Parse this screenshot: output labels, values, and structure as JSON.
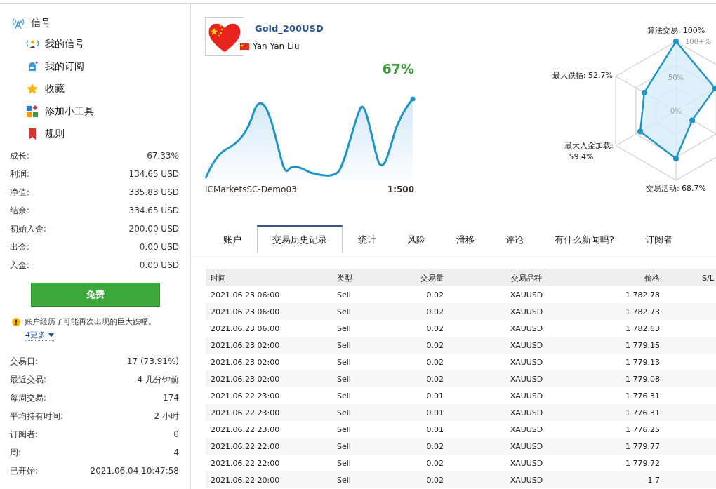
{
  "sidebar": {
    "header": "信号",
    "nav": [
      {
        "label": "我的信号",
        "kind": "signal"
      },
      {
        "label": "我的订阅",
        "kind": "subscription"
      },
      {
        "label": "收藏",
        "kind": "star"
      },
      {
        "label": "添加小工具",
        "kind": "widgets"
      },
      {
        "label": "规则",
        "kind": "bookmark"
      }
    ]
  },
  "stats": [
    {
      "label": "成长:",
      "value": "67.33%"
    },
    {
      "label": "利润:",
      "value": "134.65 USD"
    },
    {
      "label": "净值:",
      "value": "335.83 USD"
    },
    {
      "label": "结余:",
      "value": "334.65 USD"
    },
    {
      "label": "初始入金:",
      "value": "200.00 USD"
    },
    {
      "label": "出金:",
      "value": "0.00 USD"
    },
    {
      "label": "入金:",
      "value": "0.00 USD"
    }
  ],
  "free_button": "免费",
  "warning": {
    "text": "账户经历了可能再次出现的巨大跌幅。",
    "more_link": "4更多"
  },
  "stats_2": [
    {
      "label": "交易日:",
      "value": "17 (73.91%)"
    },
    {
      "label": "最近交易:",
      "value": "4 几分钟前"
    },
    {
      "label": "每周交易:",
      "value": "174"
    },
    {
      "label": "平均持有时间:",
      "value": "2 小时"
    },
    {
      "label": "订阅者:",
      "value": "0"
    },
    {
      "label": "周:",
      "value": "4"
    },
    {
      "label": "已开始:",
      "value": "2021.06.04 10:47:58"
    }
  ],
  "signal": {
    "title": "Gold_200USD",
    "author": "Yan Yan Liu",
    "growth": "67%",
    "broker": "ICMarketsSC-Demo03",
    "leverage": "1:500"
  },
  "radar": {
    "labels": [
      {
        "text": "算法交易: 100%",
        "kind": "top"
      },
      {
        "text": "最大跌幅: 52.7%",
        "kind": "upper-left"
      },
      {
        "text": "最大入金加载:",
        "kind": "lower-left"
      },
      {
        "text": "59.4%",
        "kind": "lower-left-value"
      },
      {
        "text": "交易活动: 68.7%",
        "kind": "bottom"
      }
    ],
    "ticks": [
      {
        "text": "100+%",
        "kind": "outer"
      },
      {
        "text": "50%",
        "kind": "middle"
      },
      {
        "text": "0%",
        "kind": "inner"
      }
    ]
  },
  "tabs": [
    {
      "label": "账户",
      "selected": false
    },
    {
      "label": "交易历史记录",
      "selected": true
    },
    {
      "label": "统计",
      "selected": false
    },
    {
      "label": "风险",
      "selected": false
    },
    {
      "label": "滑移",
      "selected": false
    },
    {
      "label": "评论",
      "selected": false
    },
    {
      "label": "有什么新闻吗?",
      "selected": false
    },
    {
      "label": "订阅者",
      "selected": false
    }
  ],
  "table": {
    "columns": [
      "时间",
      "类型",
      "交易量",
      "交易品种",
      "价格",
      "S/L"
    ],
    "rows": [
      [
        "2021.06.23 06:00",
        "Sell",
        "0.02",
        "XAUUSD",
        "1 782.78"
      ],
      [
        "2021.06.23 06:00",
        "Sell",
        "0.02",
        "XAUUSD",
        "1 782.73"
      ],
      [
        "2021.06.23 06:00",
        "Sell",
        "0.02",
        "XAUUSD",
        "1 782.63"
      ],
      [
        "2021.06.23 02:00",
        "Sell",
        "0.02",
        "XAUUSD",
        "1 779.15"
      ],
      [
        "2021.06.23 02:00",
        "Sell",
        "0.02",
        "XAUUSD",
        "1 779.13"
      ],
      [
        "2021.06.23 02:00",
        "Sell",
        "0.02",
        "XAUUSD",
        "1 779.08"
      ],
      [
        "2021.06.22 23:00",
        "Sell",
        "0.01",
        "XAUUSD",
        "1 776.31"
      ],
      [
        "2021.06.22 23:00",
        "Sell",
        "0.01",
        "XAUUSD",
        "1 776.31"
      ],
      [
        "2021.06.22 23:00",
        "Sell",
        "0.01",
        "XAUUSD",
        "1 776.25"
      ],
      [
        "2021.06.22 22:00",
        "Sell",
        "0.02",
        "XAUUSD",
        "1 779.77"
      ],
      [
        "2021.06.22 22:00",
        "Sell",
        "0.02",
        "XAUUSD",
        "1 779.72"
      ],
      [
        "2021.06.22 20:00",
        "Sell",
        "0.02",
        "XAUUSD",
        "1 7"
      ]
    ]
  }
}
